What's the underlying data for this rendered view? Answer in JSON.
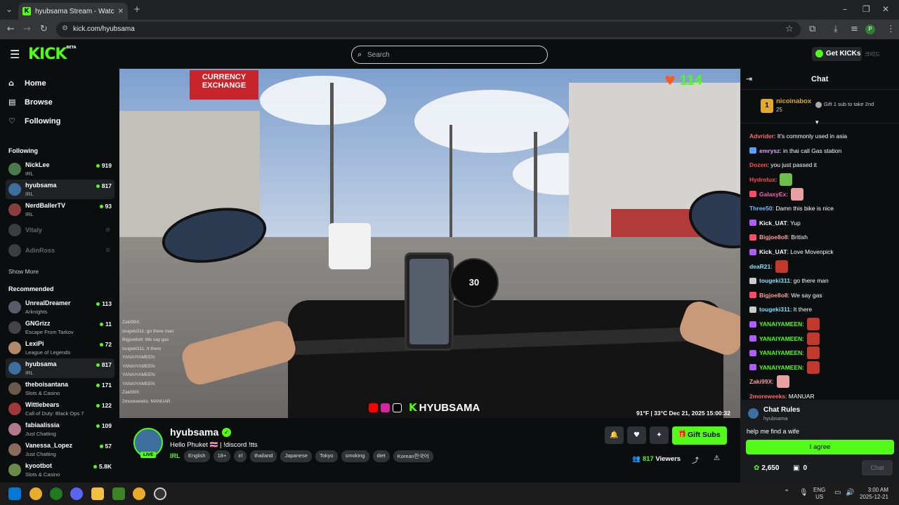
{
  "browser": {
    "tab_title": "hyubsama Stream - Watch L",
    "url": "kick.com/hyubsama"
  },
  "header": {
    "logo": "KICK",
    "beta": "BETA",
    "search_placeholder": "Search",
    "get_kicks": "Get KICKs",
    "lang": "크리드"
  },
  "nav": {
    "home": "Home",
    "browse": "Browse",
    "following": "Following"
  },
  "following": {
    "heading": "Following",
    "items": [
      {
        "name": "NickLee",
        "category": "IRL",
        "viewers": "919"
      },
      {
        "name": "hyubsama",
        "category": "IRL",
        "viewers": "817"
      },
      {
        "name": "NerdBallerTV",
        "category": "IRL",
        "viewers": "93"
      },
      {
        "name": "Vitaly",
        "category": "",
        "viewers": ""
      },
      {
        "name": "AdinRoss",
        "category": "",
        "viewers": ""
      }
    ],
    "show_more": "Show More"
  },
  "recommended": {
    "heading": "Recommended",
    "items": [
      {
        "name": "UnrealDreamer",
        "category": "Arknights",
        "viewers": "113"
      },
      {
        "name": "GNGrizz",
        "category": "Escape From Tarkov",
        "viewers": "11"
      },
      {
        "name": "LexiPi",
        "category": "League of Legends",
        "viewers": "72"
      },
      {
        "name": "hyubsama",
        "category": "IRL",
        "viewers": "817"
      },
      {
        "name": "theboisantana",
        "category": "Slots & Casino",
        "viewers": "171"
      },
      {
        "name": "Wittlebears",
        "category": "Call of Duty: Black Ops 7",
        "viewers": "122"
      },
      {
        "name": "fabiaalissia",
        "category": "Just Chatting",
        "viewers": "109"
      },
      {
        "name": "Vanessa_Lopez",
        "category": "Just Chatting",
        "viewers": "57"
      },
      {
        "name": "kyootbot",
        "category": "Slots & Casino",
        "viewers": "5.8K"
      }
    ]
  },
  "video": {
    "sign_line1": "CURRENCY",
    "sign_line2": "EXCHANGE",
    "speed": "30",
    "heart_count": "114",
    "brand": "HYUBSAMA",
    "overlay_info": "91°F | 33°C    Dec 21, 2025    15:00:32",
    "minichat": [
      "Zaki99X:",
      "tougeki311: go there man",
      "Bigjoe8o8: We say gas",
      "tougeki311: It there",
      "YANAIYAMEEN:",
      "YANAIYAMEEN:",
      "YANAIYAMEEN:",
      "YANAIYAMEEN:",
      "Zaki99X:",
      "2moreweeks: MANUAR"
    ]
  },
  "stream": {
    "name": "hyubsama",
    "live": "LIVE",
    "title": "Hello Phuket 🇹🇭 | !discord !tts",
    "category": "IRL",
    "tags": [
      "English",
      "18+",
      "irl",
      "thailand",
      "Japanese",
      "Tokyo",
      "smoking",
      "diet",
      "Korean한국어"
    ],
    "gift_subs": "Gift Subs",
    "viewers": "817",
    "viewers_label": "Viewers"
  },
  "chat": {
    "title": "Chat",
    "pinned_rank": "1",
    "pinned_name": "nicoinabox",
    "pinned_count": "25",
    "gift_prompt": "Gift 1 sub to take 2nd",
    "messages": [
      {
        "user": "Advrider",
        "color": "#ff6b6b",
        "text": ": It's commonly used in asia",
        "badge": "",
        "emote": ""
      },
      {
        "user": "emrysz",
        "color": "#d4a5ff",
        "text": ": in thai call Gas station",
        "badge": "#5aa0ff",
        "emote": ""
      },
      {
        "user": "Dozen",
        "color": "#ff4a4a",
        "text": ": you just passed it",
        "badge": "",
        "emote": ""
      },
      {
        "user": "Hydrolux",
        "color": "#ff4a4a",
        "text": ":",
        "badge": "",
        "emote": "#6fbf4a"
      },
      {
        "user": "GalaxyEx",
        "color": "#ff5fb0",
        "text": ":",
        "badge": "#ff4a6a",
        "emote": "#e8a0a0"
      },
      {
        "user": "Three50",
        "color": "#7ab8ff",
        "text": ": Damn this bike is nice",
        "badge": "",
        "emote": ""
      },
      {
        "user": "Kick_UAT",
        "color": "#ffffff",
        "text": ": Yup",
        "badge": "#b05cff",
        "emote": ""
      },
      {
        "user": "Bigjoe8o8",
        "color": "#ff9a9a",
        "text": ": British",
        "badge": "#ff4a6a",
        "emote": ""
      },
      {
        "user": "Kick_UAT",
        "color": "#ffffff",
        "text": ": Love Movenpick",
        "badge": "#b05cff",
        "emote": ""
      },
      {
        "user": "deaR21",
        "color": "#7ee0ff",
        "text": ":",
        "badge": "",
        "emote": "#c0392b"
      },
      {
        "user": "tougeki311",
        "color": "#7ee0ff",
        "text": ": go there man",
        "badge": "#cccccc",
        "emote": ""
      },
      {
        "user": "Bigjoe8o8",
        "color": "#ff9a9a",
        "text": ": We say gas",
        "badge": "#ff4a6a",
        "emote": ""
      },
      {
        "user": "tougeki311",
        "color": "#7ee0ff",
        "text": ": It there",
        "badge": "#cccccc",
        "emote": ""
      },
      {
        "user": "YANAIYAMEEN",
        "color": "#53fc18",
        "text": ":",
        "badge": "#b05cff",
        "emote": "#c0392b"
      },
      {
        "user": "YANAIYAMEEN",
        "color": "#53fc18",
        "text": ":",
        "badge": "#b05cff",
        "emote": "#c0392b"
      },
      {
        "user": "YANAIYAMEEN",
        "color": "#53fc18",
        "text": ":",
        "badge": "#b05cff",
        "emote": "#c0392b"
      },
      {
        "user": "YANAIYAMEEN",
        "color": "#53fc18",
        "text": ":",
        "badge": "#b05cff",
        "emote": "#c0392b"
      },
      {
        "user": "Zaki99X",
        "color": "#ff9a9a",
        "text": ":",
        "badge": "",
        "emote": "#e8a0a0"
      },
      {
        "user": "2moreweeks",
        "color": "#ff6b6b",
        "text": ": MANUAR",
        "badge": "",
        "emote": ""
      }
    ],
    "rules_title": "Chat Rules",
    "rules_user": "hyubsama",
    "rules_text": "help me find a wife",
    "agree": "I agree",
    "points": "2,650",
    "gifts": "0",
    "send": "Chat"
  },
  "taskbar": {
    "lang1": "ENG",
    "lang2": "US",
    "time": "3:00 AM",
    "date": "2025-12-21"
  },
  "colors": {
    "accent": "#53fc18",
    "bg": "#0b0e0f"
  }
}
